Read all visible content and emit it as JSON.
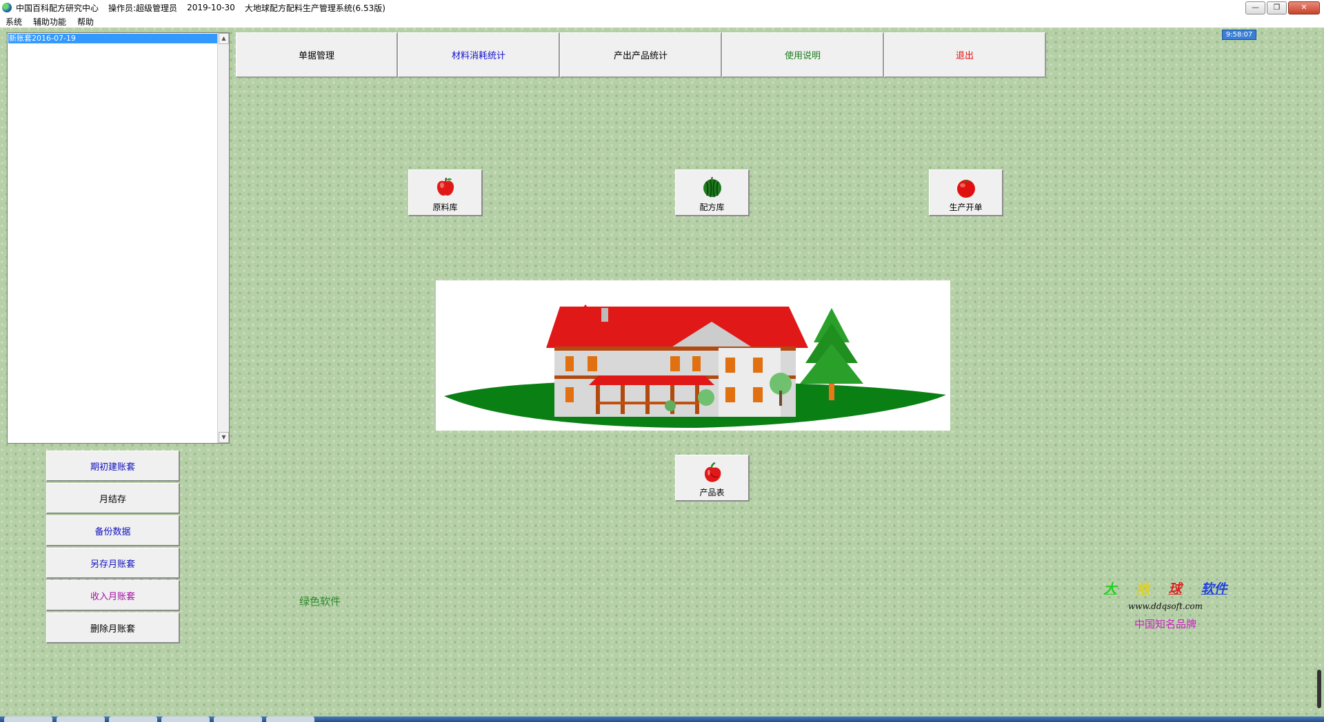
{
  "window": {
    "company": "中国百科配方研究中心",
    "operator": "操作员:超级管理员",
    "date": "2019-10-30",
    "app_title": "大地球配方配料生产管理系统(6.53版)",
    "controls": {
      "minimize": "—",
      "restore": "❐",
      "close": "✕"
    }
  },
  "menu": [
    "系统",
    "辅助功能",
    "帮助"
  ],
  "account_list": {
    "items": [
      "新账套2016-07-19"
    ]
  },
  "top_buttons": [
    {
      "label": "单据管理",
      "color": "#000000"
    },
    {
      "label": "材料消耗统计",
      "color": "#1010d0"
    },
    {
      "label": "产出产品统计",
      "color": "#000000"
    },
    {
      "label": "使用说明",
      "color": "#1a7a1a"
    },
    {
      "label": "退出",
      "color": "#e01010"
    }
  ],
  "clock": "9:58:07",
  "icon_buttons": {
    "raw_material": {
      "label": "原料库",
      "icon": "apple-icon"
    },
    "formula": {
      "label": "配方库",
      "icon": "watermelon-icon"
    },
    "production": {
      "label": "生产开单",
      "icon": "tomato-icon"
    },
    "product": {
      "label": "产品表",
      "icon": "pepper-icon"
    }
  },
  "side_buttons": [
    {
      "label": "期初建账套",
      "color": "#1010c0"
    },
    {
      "label": "月结存",
      "color": "#000000"
    },
    {
      "label": "备份数据",
      "color": "#1010c0"
    },
    {
      "label": "另存月账套",
      "color": "#1010c0"
    },
    {
      "label": "收入月账套",
      "color": "#a010a0"
    },
    {
      "label": "删除月账套",
      "color": "#000000"
    }
  ],
  "green_text": "绿色软件",
  "brand": {
    "chars": [
      {
        "ch": "大",
        "color": "#20d020"
      },
      {
        "ch": "地",
        "color": "#e0d020"
      },
      {
        "ch": "球",
        "color": "#e02020"
      },
      {
        "ch": "软件",
        "color": "#2040e0"
      }
    ],
    "url": "www.ddqsoft.com",
    "tagline": "中国知名品牌"
  }
}
